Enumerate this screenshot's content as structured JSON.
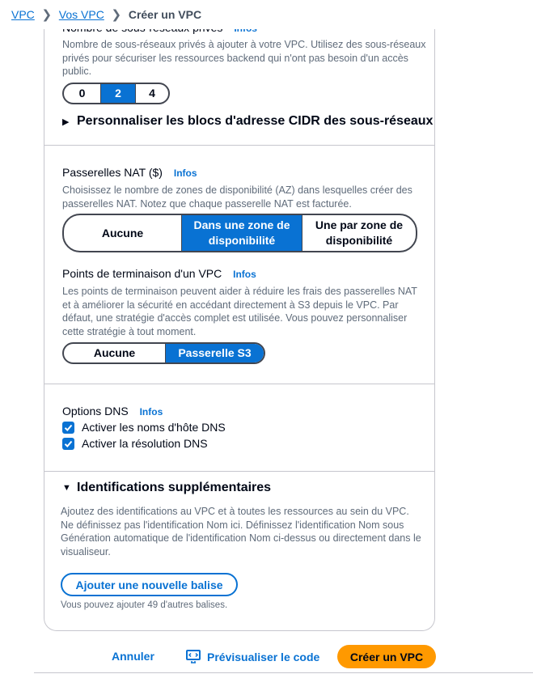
{
  "breadcrumb": {
    "items": [
      "VPC",
      "Vos VPC"
    ],
    "current": "Créer un VPC"
  },
  "private_subnets": {
    "label_cut": "Nombre de sous-réseaux privés",
    "info": "Infos",
    "description": "Nombre de sous-réseaux privés à ajouter à votre VPC. Utilisez des sous-réseaux privés pour sécuriser les ressources backend qui n'ont pas besoin d'un accès public.",
    "options": [
      "0",
      "2",
      "4"
    ],
    "selected": "2"
  },
  "cidr_expander": {
    "label": "Personnaliser les blocs d'adresse CIDR des sous-réseaux",
    "expanded": false
  },
  "nat": {
    "label": "Passerelles NAT ($)",
    "info": "Infos",
    "description": "Choisissez le nombre de zones de disponibilité (AZ) dans lesquelles créer des passerelles NAT. Notez que chaque passerelle NAT est facturée.",
    "options": [
      "Aucune",
      "Dans une zone de disponibilité",
      "Une par zone de disponibilité"
    ],
    "selected": "Dans une zone de disponibilité"
  },
  "endpoints": {
    "label": "Points de terminaison d'un VPC",
    "info": "Infos",
    "description": "Les points de terminaison peuvent aider à réduire les frais des passerelles NAT et à améliorer la sécurité en accédant directement à S3 depuis le VPC. Par défaut, une stratégie d'accès complet est utilisée. Vous pouvez personnaliser cette stratégie à tout moment.",
    "options": [
      "Aucune",
      "Passerelle S3"
    ],
    "selected": "Passerelle S3"
  },
  "dns": {
    "label": "Options DNS",
    "info": "Infos",
    "hostnames": {
      "label": "Activer les noms d'hôte DNS",
      "checked": true
    },
    "resolution": {
      "label": "Activer la résolution DNS",
      "checked": true
    }
  },
  "tags": {
    "header": "Identifications supplémentaires",
    "expanded": true,
    "description": "Ajoutez des identifications au VPC et à toutes les ressources au sein du VPC. Ne définissez pas l'identification Nom ici. Définissez l'identification Nom sous Génération automatique de l'identification Nom ci-dessus ou directement dans le visualiseur.",
    "add_button": "Ajouter une nouvelle balise",
    "remaining": "Vous pouvez ajouter 49 d'autres balises."
  },
  "footer": {
    "cancel": "Annuler",
    "preview": "Prévisualiser le code",
    "create": "Créer un VPC"
  },
  "colors": {
    "accent": "#0972d3",
    "primary_button": "#ff9900",
    "text": "#000716",
    "muted": "#5f6b7a"
  }
}
